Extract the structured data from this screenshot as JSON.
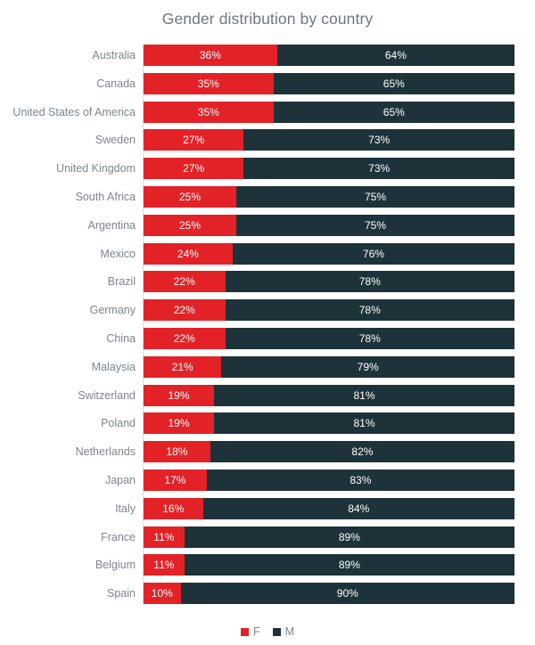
{
  "chart_data": {
    "type": "bar",
    "subtype": "stacked-horizontal-100",
    "title": "Gender distribution by country",
    "xlabel": "",
    "ylabel": "",
    "xlim": [
      0,
      100
    ],
    "grid": false,
    "legend_position": "bottom",
    "categories": [
      "Australia",
      "Canada",
      "United States of America",
      "Sweden",
      "United Kingdom",
      "South Africa",
      "Argentina",
      "Mexico",
      "Brazil",
      "Germany",
      "China",
      "Malaysia",
      "Switzerland",
      "Poland",
      "Netherlands",
      "Japan",
      "Italy",
      "France",
      "Belgium",
      "Spain"
    ],
    "series": [
      {
        "name": "F",
        "color": "#e32227",
        "values": [
          36,
          35,
          35,
          27,
          27,
          25,
          25,
          24,
          22,
          22,
          22,
          21,
          19,
          19,
          18,
          17,
          16,
          11,
          11,
          10
        ],
        "labels": [
          "36%",
          "35%",
          "35%",
          "27%",
          "27%",
          "25%",
          "25%",
          "24%",
          "22%",
          "22%",
          "22%",
          "21%",
          "19%",
          "19%",
          "18%",
          "17%",
          "16%",
          "11%",
          "11%",
          "10%"
        ]
      },
      {
        "name": "M",
        "color": "#1d3339",
        "values": [
          64,
          65,
          65,
          73,
          73,
          75,
          75,
          76,
          78,
          78,
          78,
          79,
          81,
          81,
          82,
          83,
          84,
          89,
          89,
          90
        ],
        "labels": [
          "64%",
          "65%",
          "65%",
          "73%",
          "73%",
          "75%",
          "75%",
          "76%",
          "78%",
          "78%",
          "78%",
          "79%",
          "81%",
          "81%",
          "82%",
          "83%",
          "84%",
          "89%",
          "89%",
          "90%"
        ]
      }
    ],
    "legend": [
      {
        "label": "F",
        "color": "#e32227",
        "swatch": "square-swatch-f"
      },
      {
        "label": "M",
        "color": "#1d3339",
        "swatch": "square-swatch-m"
      }
    ],
    "colors": {
      "female": "#e32227",
      "male": "#1d3339",
      "title_text": "#6e767d",
      "label_text": "#7d858c",
      "value_text": "#ffffff",
      "axis_line": "#d9dadb",
      "background": "#ffffff"
    }
  }
}
